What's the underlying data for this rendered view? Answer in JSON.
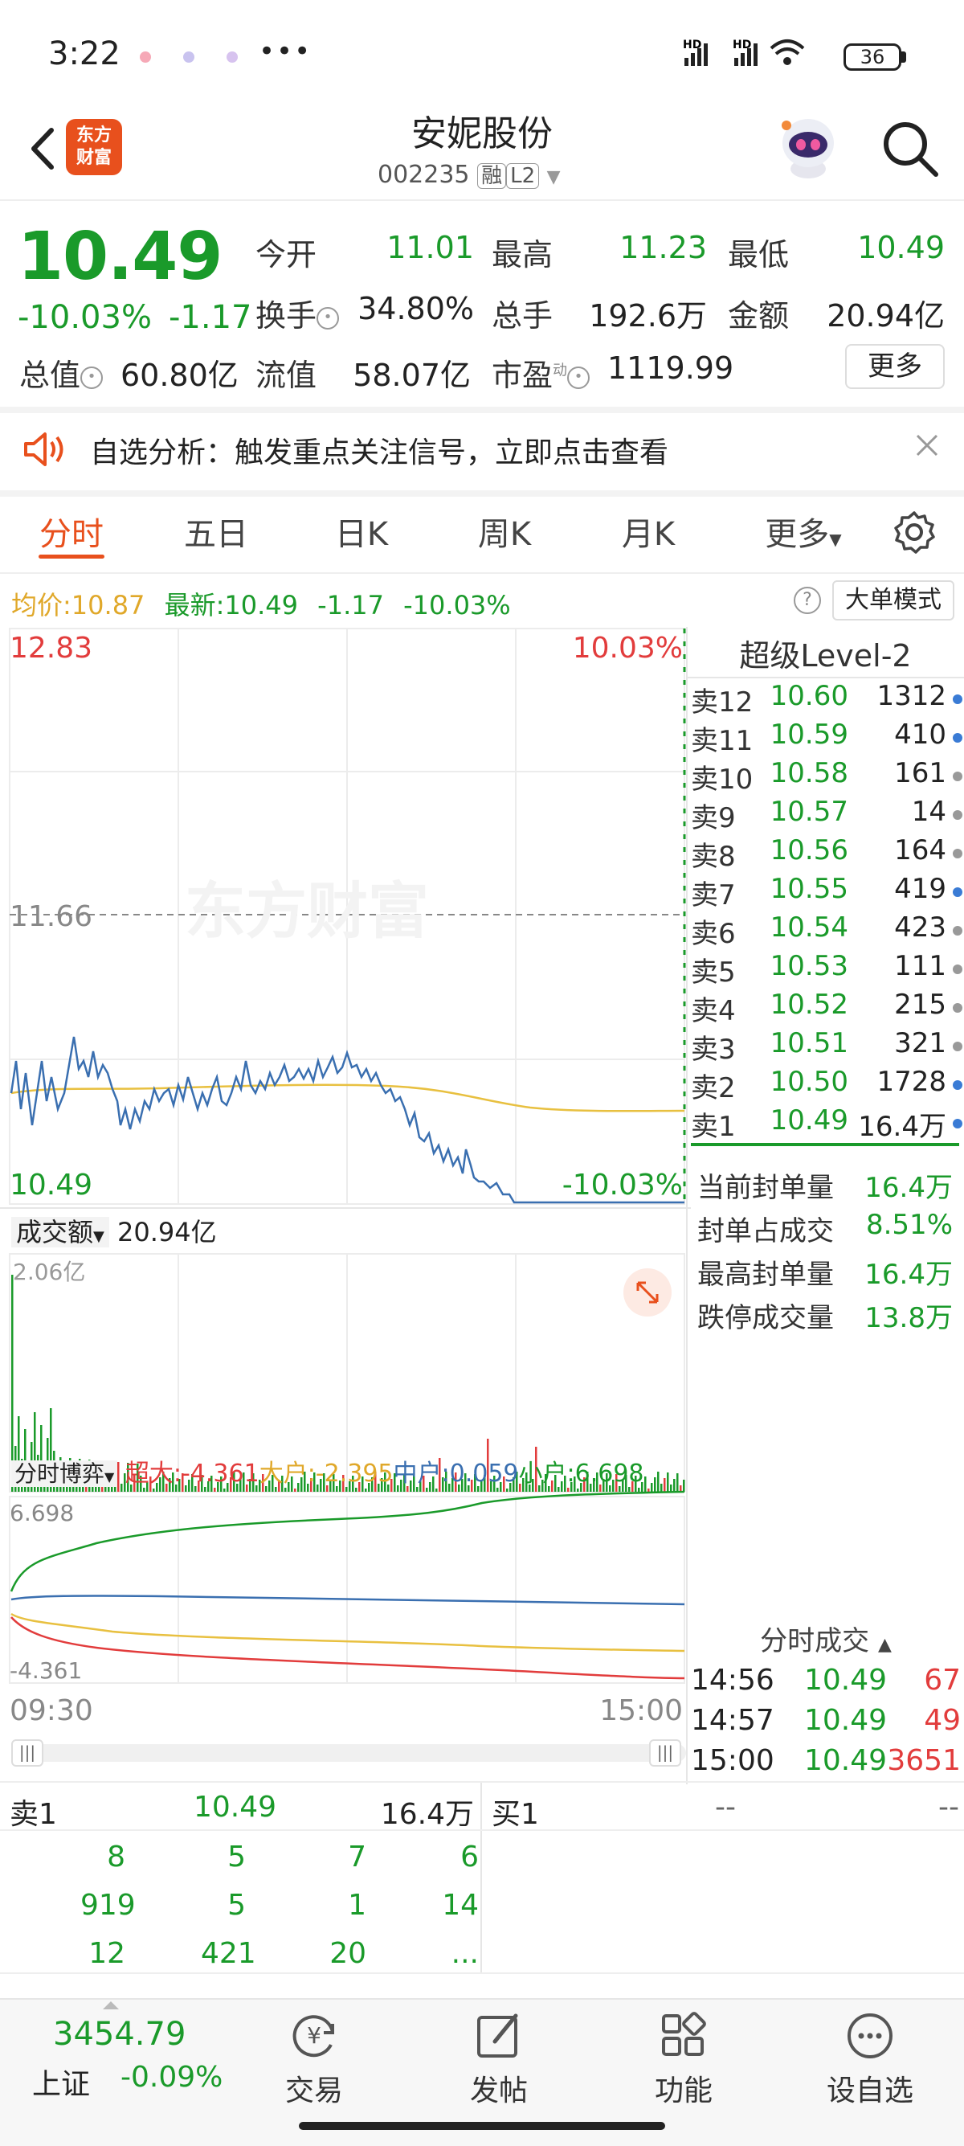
{
  "status": {
    "time": "3:22",
    "battery": "36"
  },
  "header": {
    "back": "<",
    "logo_line1": "东方",
    "logo_line2": "财富",
    "name": "安妮股份",
    "code": "002235",
    "tag_rong": "融",
    "tag_l2": "L2"
  },
  "quote": {
    "price": "10.49",
    "pct": "-10.03%",
    "chg": "-1.17",
    "labels": {
      "open": "今开",
      "high": "最高",
      "low": "最低",
      "turnover": "换手",
      "vol": "总手",
      "amount": "金额",
      "mcap": "总值",
      "float": "流值",
      "pe": "市盈"
    },
    "open": "11.01",
    "high": "11.23",
    "low": "10.49",
    "turnover": "34.80%",
    "vol": "192.6万",
    "amount": "20.94亿",
    "mcap": "60.80亿",
    "float": "58.07亿",
    "pe_sup": "动",
    "pe": "1119.99",
    "more": "更多"
  },
  "notice": {
    "text": "自选分析：触发重点关注信号，立即点击查看"
  },
  "tabs": [
    "分时",
    "五日",
    "日K",
    "周K",
    "月K",
    "更多"
  ],
  "avgline": {
    "avg_label": "均价:",
    "avg": "10.87",
    "last_label": "最新:",
    "last": "10.49",
    "chg": "-1.17",
    "pct": "-10.03%",
    "mode": "大单模式",
    "help": "?"
  },
  "chart_labels": {
    "ymax": "12.83",
    "pmax": "10.03%",
    "ymid": "11.66",
    "ymin": "10.49",
    "pmin": "-10.03%",
    "watermark": "东方财富",
    "amount_label": "成交额",
    "amount_value": "20.94亿",
    "amount_max": "2.06亿",
    "flow_label": "分时博弈",
    "flow_super": "超大:-4.361",
    "flow_big": "大户:-2.395",
    "flow_mid": "中户:0.059",
    "flow_small": "小户:6.698",
    "flow_max": "6.698",
    "flow_min": "-4.361",
    "time_start": "09:30",
    "time_end": "15:00"
  },
  "level2": {
    "title": "超级Level-2",
    "asks": [
      {
        "label": "卖12",
        "price": "10.60",
        "vol": "1312",
        "dot": "#3a7bd5"
      },
      {
        "label": "卖11",
        "price": "10.59",
        "vol": "410",
        "dot": "#3a7bd5"
      },
      {
        "label": "卖10",
        "price": "10.58",
        "vol": "161",
        "dot": "#999999"
      },
      {
        "label": "卖9",
        "price": "10.57",
        "vol": "14",
        "dot": "#999999"
      },
      {
        "label": "卖8",
        "price": "10.56",
        "vol": "164",
        "dot": "#999999"
      },
      {
        "label": "卖7",
        "price": "10.55",
        "vol": "419",
        "dot": "#3a7bd5"
      },
      {
        "label": "卖6",
        "price": "10.54",
        "vol": "423",
        "dot": "#999999"
      },
      {
        "label": "卖5",
        "price": "10.53",
        "vol": "111",
        "dot": "#999999"
      },
      {
        "label": "卖4",
        "price": "10.52",
        "vol": "215",
        "dot": "#999999"
      },
      {
        "label": "卖3",
        "price": "10.51",
        "vol": "321",
        "dot": "#999999"
      },
      {
        "label": "卖2",
        "price": "10.50",
        "vol": "1728",
        "dot": "#3a7bd5"
      },
      {
        "label": "卖1",
        "price": "10.49",
        "vol": "16.4万",
        "dot": "#3a7bd5"
      }
    ],
    "stats": [
      {
        "label": "当前封单量",
        "value": "16.4万"
      },
      {
        "label": "封单占成交",
        "value": "8.51%"
      },
      {
        "label": "最高封单量",
        "value": "16.4万"
      },
      {
        "label": "跌停成交量",
        "value": "13.8万"
      }
    ],
    "trades_title": "分时成交",
    "trades": [
      {
        "time": "14:56",
        "price": "10.49",
        "vol": "67"
      },
      {
        "time": "14:57",
        "price": "10.49",
        "vol": "49"
      },
      {
        "time": "15:00",
        "price": "10.49",
        "vol": "3651"
      }
    ]
  },
  "bottom_table": {
    "sell_label": "卖1",
    "sell_price": "10.49",
    "sell_vol": "16.4万",
    "buy_label": "买1",
    "buy_price": "--",
    "buy_vol": "--",
    "queue": [
      [
        "8",
        "5",
        "7",
        "6"
      ],
      [
        "919",
        "5",
        "1",
        "14"
      ],
      [
        "12",
        "421",
        "20",
        "..."
      ]
    ]
  },
  "bottomnav": {
    "index_value": "3454.79",
    "index_name": "上证",
    "index_pct": "-0.09%",
    "items": [
      "交易",
      "发帖",
      "功能",
      "设自选"
    ]
  },
  "colors": {
    "up": "#e23c3c",
    "down": "#1a9a2a",
    "accent": "#e8501d",
    "price_line": "#3a6fb0",
    "avg_line": "#e8c040"
  }
}
